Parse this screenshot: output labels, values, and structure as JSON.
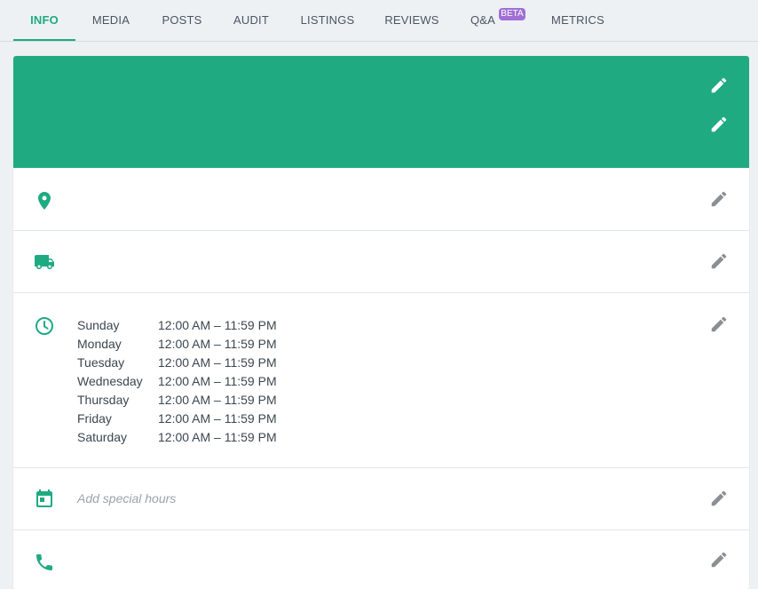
{
  "tabs": [
    {
      "label": "INFO"
    },
    {
      "label": "MEDIA"
    },
    {
      "label": "POSTS"
    },
    {
      "label": "AUDIT"
    },
    {
      "label": "LISTINGS"
    },
    {
      "label": "REVIEWS"
    },
    {
      "label": "Q&A"
    },
    {
      "label": "METRICS"
    }
  ],
  "beta_badge": "BETA",
  "active_tab": "INFO",
  "colors": {
    "accent": "#1faa82",
    "beta": "#a06fd6",
    "edit_gray": "#8a8f94"
  },
  "rows": {
    "address": {
      "icon": "map-pin-icon"
    },
    "delivery": {
      "icon": "truck-icon"
    },
    "hours": {
      "icon": "clock-icon",
      "days": [
        {
          "day": "Sunday",
          "time": "12:00 AM – 11:59 PM"
        },
        {
          "day": "Monday",
          "time": "12:00 AM – 11:59 PM"
        },
        {
          "day": "Tuesday",
          "time": "12:00 AM – 11:59 PM"
        },
        {
          "day": "Wednesday",
          "time": "12:00 AM – 11:59 PM"
        },
        {
          "day": "Thursday",
          "time": "12:00 AM – 11:59 PM"
        },
        {
          "day": "Friday",
          "time": "12:00 AM – 11:59 PM"
        },
        {
          "day": "Saturday",
          "time": "12:00 AM – 11:59 PM"
        }
      ]
    },
    "special_hours": {
      "icon": "calendar-icon",
      "placeholder": "Add special hours"
    },
    "phone": {
      "icon": "phone-icon"
    }
  }
}
